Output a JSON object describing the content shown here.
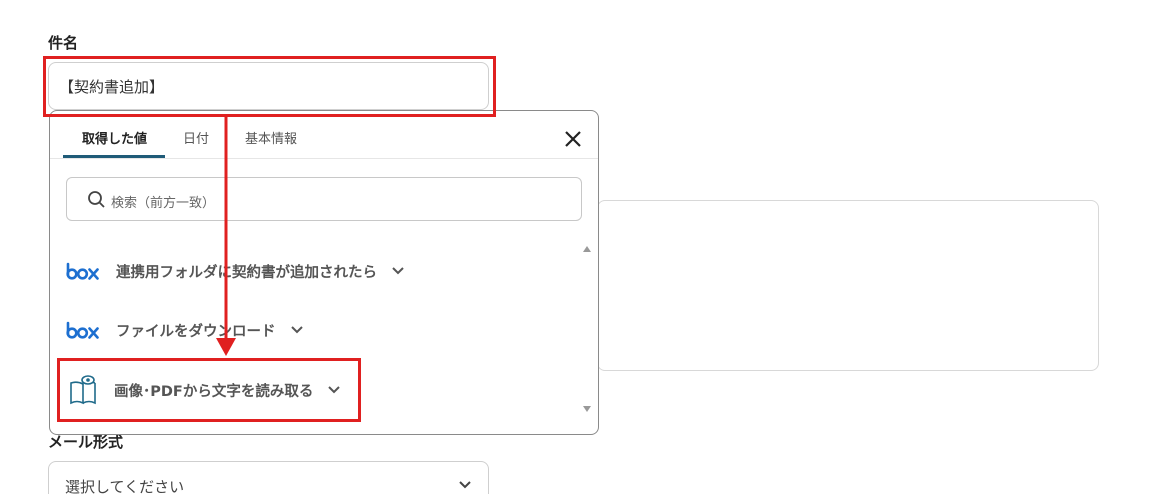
{
  "subject": {
    "label": "件名",
    "value": "【契約書追加】"
  },
  "mail_format": {
    "label": "メール形式",
    "placeholder": "選択してください"
  },
  "popover": {
    "tabs": [
      {
        "label": "取得した値",
        "active": true
      },
      {
        "label": "日付",
        "active": false
      },
      {
        "label": "基本情報",
        "active": false
      }
    ],
    "search_placeholder": "検索（前方一致）",
    "items": [
      {
        "icon": "box-logo-icon",
        "label": "連携用フォルダに契約書が追加されたら"
      },
      {
        "icon": "box-logo-icon",
        "label": "ファイルをダウンロード"
      },
      {
        "icon": "ocr-book-eye-icon",
        "label": "画像･PDFから文字を読み取る"
      }
    ]
  },
  "colors": {
    "highlight": "#e02020",
    "tab_underline": "#1f5b78",
    "box_brand": "#1d6fd0",
    "ocr_icon": "#1f6a8a"
  }
}
